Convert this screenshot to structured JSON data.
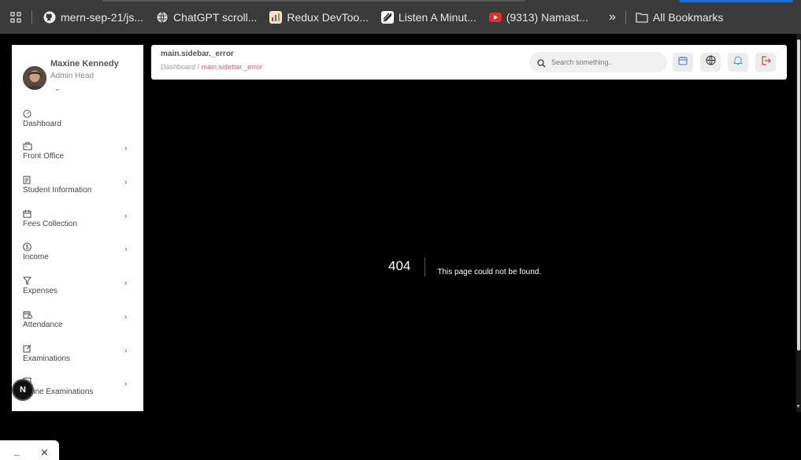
{
  "bookmarks": {
    "items": [
      {
        "label": "mern-sep-21/js...",
        "icon": "github-icon"
      },
      {
        "label": "ChatGPT scroll...",
        "icon": "globe-icon"
      },
      {
        "label": "Redux DevToo...",
        "icon": "redux-icon"
      },
      {
        "label": "Listen A Minut...",
        "icon": "listen-icon"
      },
      {
        "label": "(9313) Namast...",
        "icon": "youtube-icon"
      }
    ],
    "more_label": "»",
    "all_bookmarks_label": "All Bookmarks"
  },
  "sidebar": {
    "user_name": "Maxine Kennedy",
    "user_role": "Admin Head",
    "chevron": "⌄",
    "items": [
      {
        "label": "Dashboard",
        "icon": "dashboard-icon",
        "has_children": false
      },
      {
        "label": "Front Office",
        "icon": "front-office-icon",
        "has_children": true
      },
      {
        "label": "Student Information",
        "icon": "student-information-icon",
        "has_children": true
      },
      {
        "label": "Fees Collection",
        "icon": "calendar-icon",
        "has_children": true
      },
      {
        "label": "Income",
        "icon": "dollar-icon",
        "has_children": true
      },
      {
        "label": "Expenses",
        "icon": "filter-icon",
        "has_children": true
      },
      {
        "label": "Attendance",
        "icon": "attendance-icon",
        "has_children": true
      },
      {
        "label": "Examinations",
        "icon": "edit-icon",
        "has_children": true
      },
      {
        "label": "line Examinations",
        "icon": "online-exam-icon",
        "has_children": true
      }
    ],
    "item_chevron": "›"
  },
  "header": {
    "title": "main.sidebar._error",
    "breadcrumb": {
      "root": "Dashboard",
      "separator": " / ",
      "current": "main.sidebar._error"
    },
    "search_placeholder": "Search something.."
  },
  "not_found": {
    "code": "404",
    "message": "This page could not be found."
  },
  "next_badge": "N",
  "mini_panel": {
    "minimize": "_",
    "close": "✕"
  },
  "colors": {
    "accent_red": "#e0566a",
    "bell_blue": "#3aa0d8",
    "logout_red": "#e23b3b",
    "calendar_blue": "#3a6fd8"
  }
}
